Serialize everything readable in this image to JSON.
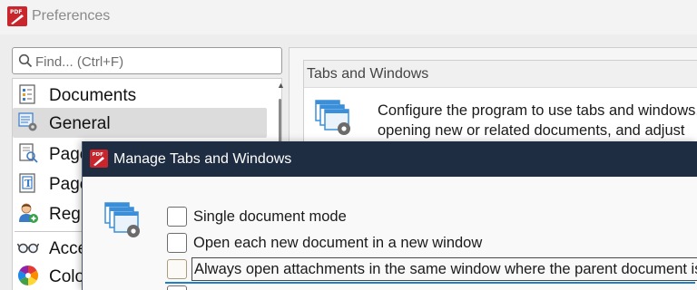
{
  "window": {
    "title": "Preferences"
  },
  "search": {
    "placeholder": "Find... (Ctrl+F)"
  },
  "sidebar": {
    "items": [
      {
        "label": "Documents",
        "icon": "documents-icon"
      },
      {
        "label": "General",
        "icon": "general-settings-icon",
        "selected": true
      },
      {
        "label": "Page",
        "icon": "page-display-icon"
      },
      {
        "label": "Page",
        "icon": "page-text-icon"
      },
      {
        "label": "Regi",
        "icon": "user-add-icon"
      },
      {
        "label": "Acce",
        "icon": "glasses-icon"
      },
      {
        "label": "Colo",
        "icon": "color-wheel-icon"
      }
    ]
  },
  "panel": {
    "group_title": "Tabs and Windows",
    "description_line1": "Configure the program to use tabs and windows,",
    "description_line2": "opening new or related documents, and adjust"
  },
  "dialog": {
    "title": "Manage Tabs and Windows",
    "options": [
      {
        "label": "Single document mode",
        "checked": false
      },
      {
        "label": "Open each new document in a new window",
        "checked": false
      },
      {
        "label": "Always open attachments in the same window where the parent document is",
        "checked": false,
        "focused": true
      }
    ]
  },
  "colors": {
    "dialog_titlebar": "#1e2d42",
    "focus_accent": "#1f80c8",
    "app_brand_red": "#c8262c"
  }
}
